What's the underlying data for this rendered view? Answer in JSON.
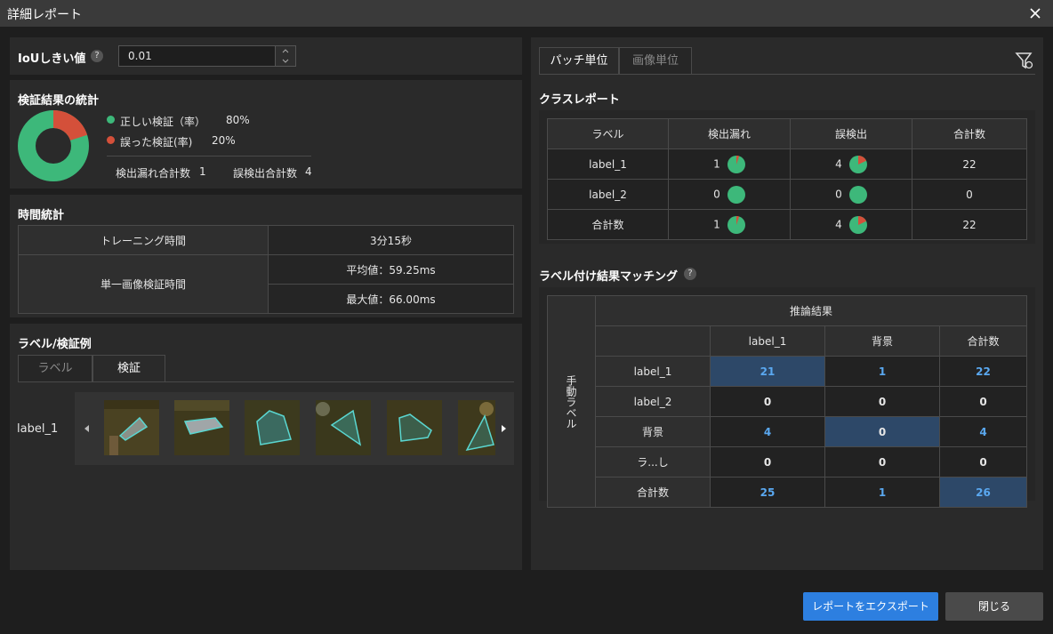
{
  "window": {
    "title": "詳細レポート"
  },
  "iou": {
    "label": "IoUしきい値",
    "help": "?",
    "value": "0.01"
  },
  "stats": {
    "title": "検証結果の統計",
    "correct_label": "正しい検証（率）",
    "correct_value": "80%",
    "wrong_label": "誤った検証(率)",
    "wrong_value": "20%",
    "missed_label": "検出漏れ合計数",
    "missed_value": "1",
    "false_label": "誤検出合計数",
    "false_value": "4",
    "correct_fraction": 0.8,
    "colors": {
      "correct": "#3db87a",
      "wrong": "#d4503a"
    }
  },
  "time": {
    "title": "時間統計",
    "training_label": "トレーニング時間",
    "training_value": "3分15秒",
    "single_label": "単一画像検証時間",
    "avg": "平均値：59.25ms",
    "max": "最大値：66.00ms"
  },
  "examples": {
    "title": "ラベル/検証例",
    "tabs": [
      "ラベル",
      "検証"
    ],
    "row_label": "label_1"
  },
  "right_tabs": [
    "パッチ単位",
    "画像単位"
  ],
  "class_report": {
    "title": "クラスレポート",
    "headers": [
      "ラベル",
      "検出漏れ",
      "誤検出",
      "合計数"
    ],
    "rows": [
      {
        "label": "label_1",
        "missed": "1",
        "false": "4",
        "total": "22",
        "missed_frac": 0.05,
        "false_frac": 0.18
      },
      {
        "label": "label_2",
        "missed": "0",
        "false": "0",
        "total": "0",
        "missed_frac": 0,
        "false_frac": 0
      },
      {
        "label": "合計数",
        "missed": "1",
        "false": "4",
        "total": "22",
        "missed_frac": 0.05,
        "false_frac": 0.18
      }
    ]
  },
  "matching": {
    "title": "ラベル付け結果マッチング",
    "help": "?",
    "col_group": "推論結果",
    "row_group": "手動ラベル",
    "cols": [
      "label_1",
      "背景",
      "合計数"
    ],
    "rows": [
      {
        "label": "label_1",
        "cells": [
          "21",
          "1",
          "22"
        ]
      },
      {
        "label": "label_2",
        "cells": [
          "0",
          "0",
          "0"
        ]
      },
      {
        "label": "背景",
        "cells": [
          "4",
          "0",
          "4"
        ]
      },
      {
        "label": "ラ...し",
        "cells": [
          "0",
          "0",
          "0"
        ]
      },
      {
        "label": "合計数",
        "cells": [
          "25",
          "1",
          "26"
        ]
      }
    ]
  },
  "buttons": {
    "export": "レポートをエクスポート",
    "close": "閉じる"
  }
}
